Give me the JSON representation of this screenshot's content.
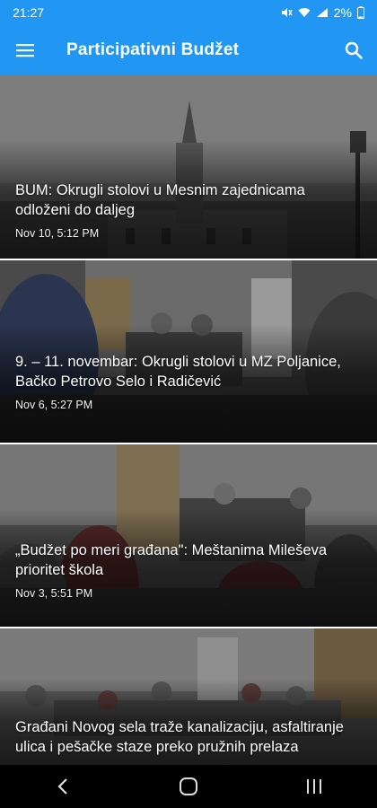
{
  "status_bar": {
    "time": "21:27",
    "battery": "2%"
  },
  "app_bar": {
    "title": "Participativni Budžet",
    "menu_icon": "hamburger-menu-icon",
    "search_icon": "search-icon"
  },
  "colors": {
    "primary": "#2196f3",
    "nav_bar": "#000000"
  },
  "articles": [
    {
      "title": "BUM: Okrugli stolovi u Mesnim zajednicama odloženi do daljeg",
      "date": "Nov 10, 5:12 PM"
    },
    {
      "title": "9. – 11. novembar: Okrugli stolovi u MZ Poljanice, Bačko Petrovo Selo i Radičević",
      "date": "Nov 6, 5:27 PM"
    },
    {
      "title": "„Budžet po meri građana\": Meštanima Mileševa prioritet škola",
      "date": "Nov 3, 5:51 PM"
    },
    {
      "title": "Građani Novog sela traže kanalizaciju, asfaltiranje ulica i pešačke staze preko pružnih prelaza"
    }
  ],
  "nav_bar": {
    "back_icon": "back-icon",
    "home_icon": "home-icon",
    "recents_icon": "recents-icon"
  }
}
